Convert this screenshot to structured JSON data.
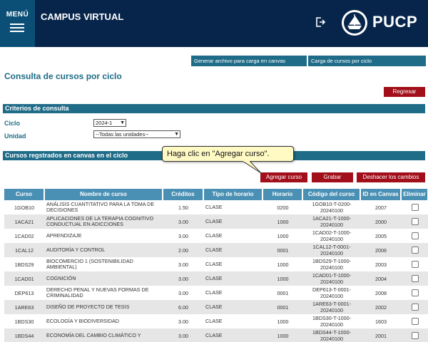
{
  "header": {
    "menu_label": "MENÚ",
    "app_title": "CAMPUS VIRTUAL",
    "logo_text": "PUCP",
    "bg_color": "#07254a",
    "menu_bg_color": "#0b4f77"
  },
  "top_links": {
    "generar": "Generar archivo para carga en canvas",
    "carga": "Carga de cursos por ciclo"
  },
  "page_title": "Consulta de cursos por ciclo",
  "buttons": {
    "regresar": "Regresar",
    "agregar": "Agregar curso",
    "grabar": "Grabar",
    "deshacer": "Deshacer los cambios"
  },
  "sections": {
    "criterios": "Criterios de consulta",
    "cursos": "Cursos regstrados en canvas en el ciclo"
  },
  "filters": {
    "ciclo_label": "Ciclo",
    "ciclo_value": "2024-1",
    "unidad_label": "Unidad",
    "unidad_value": "--Todas las unidades--"
  },
  "tooltip": "Haga clic en \"Agregar curso\".",
  "table": {
    "headers": [
      "Curso",
      "Nombre de curso",
      "Créditos",
      "Tipo de horario",
      "Horario",
      "Código del curso",
      "ID en Canvas",
      "Eliminar"
    ],
    "rows": [
      {
        "curso": "1GOB10",
        "nombre": "ANÁLISIS CUANTITATIVO PARA LA TOMA DE DECISIONES",
        "creditos": "1.50",
        "tipo": "CLASE",
        "horario": "0200",
        "codigo": "1GOB10-T-0200-20240100",
        "canvas": "2007"
      },
      {
        "curso": "1ACA21",
        "nombre": "APLICACIONES DE LA TERAPIA COGNITIVO CONDUCTUAL EN ADICCIONES",
        "creditos": "3.00",
        "tipo": "CLASE",
        "horario": "1000",
        "codigo": "1ACA21-T-1000-20240100",
        "canvas": "2000"
      },
      {
        "curso": "1CAD02",
        "nombre": "APRENDIZAJE",
        "creditos": "3.00",
        "tipo": "CLASE",
        "horario": "1000",
        "codigo": "1CAD02-T-1000-20240100",
        "canvas": "2005"
      },
      {
        "curso": "1CAL12",
        "nombre": "AUDITORÍA Y CONTROL",
        "creditos": "2.00",
        "tipo": "CLASE",
        "horario": "0001",
        "codigo": "1CAL12-T-0001-20240100",
        "canvas": "2006"
      },
      {
        "curso": "1BDS29",
        "nombre": "BIOCOMERCIO 1 (SOSTENIBILIDAD AMBIENTAL)",
        "creditos": "3.00",
        "tipo": "CLASE",
        "horario": "1000",
        "codigo": "1BDS29-T-1000-20240100",
        "canvas": "2003"
      },
      {
        "curso": "1CAD01",
        "nombre": "COGNICIÓN",
        "creditos": "3.00",
        "tipo": "CLASE",
        "horario": "1000",
        "codigo": "1CAD01-T-1000-20240100",
        "canvas": "2004"
      },
      {
        "curso": "DEP613",
        "nombre": "DERECHO PENAL Y NUEVAS FORMAS DE CRIMINALIDAD",
        "creditos": "3.00",
        "tipo": "CLASE",
        "horario": "0001",
        "codigo": "DEP613-T-0001-20240100",
        "canvas": "2008"
      },
      {
        "curso": "1ARE63",
        "nombre": "DISEÑO DE PROYECTO DE TESIS",
        "creditos": "6.00",
        "tipo": "CLASE",
        "horario": "0001",
        "codigo": "1ARE63-T-0001-20240100",
        "canvas": "2002"
      },
      {
        "curso": "1BDS30",
        "nombre": "ECOLOGÍA Y BIODIVERSIDAD",
        "creditos": "3.00",
        "tipo": "CLASE",
        "horario": "1000",
        "codigo": "1BDS30-T-1000-20240100",
        "canvas": "1603"
      },
      {
        "curso": "1BDS44",
        "nombre": "ECONOMÍA DEL CAMBIO CLIMÁTICO Y",
        "creditos": "3.00",
        "tipo": "CLASE",
        "horario": "1000",
        "codigo": "1BDS44-T-1000-20240100",
        "canvas": "2001"
      }
    ]
  }
}
